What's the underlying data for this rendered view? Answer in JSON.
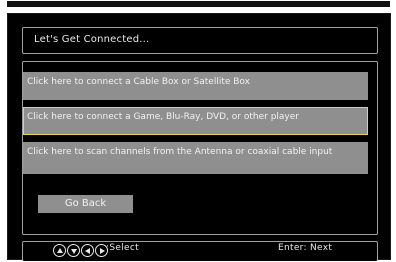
{
  "dialog": {
    "title": "Let's Get Connected..."
  },
  "options": [
    {
      "label": "Click here to connect a Cable Box or Satellite Box"
    },
    {
      "label": "Click here to connect a Game, Blu-Ray, DVD, or other player"
    },
    {
      "label": "Click here to scan channels from the Antenna or coaxial cable input"
    }
  ],
  "back_button": {
    "label": "Go Back"
  },
  "footer": {
    "select_hint": ":Select",
    "enter_hint": "Enter: Next",
    "nav_icons": [
      "arrow-up-icon",
      "arrow-down-icon",
      "arrow-left-icon",
      "arrow-right-icon"
    ]
  },
  "colors": {
    "background": "#000000",
    "option_bg": "#8f8f8f",
    "selected_border": "#e6d84a",
    "text": "#f2f2f2"
  }
}
